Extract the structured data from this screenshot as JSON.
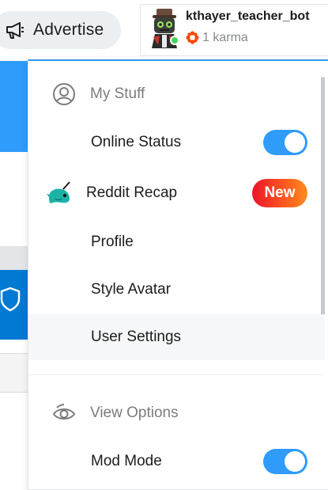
{
  "header": {
    "advertise_label": "Advertise",
    "icon": "megaphone-icon"
  },
  "user": {
    "username": "kthayer_teacher_bot",
    "karma": "1 karma",
    "status_color": "#46d160"
  },
  "menu": {
    "my_stuff": {
      "label": "My Stuff",
      "icon": "user-circle-icon",
      "items": {
        "online_status": {
          "label": "Online Status",
          "toggle": "on"
        },
        "reddit_recap": {
          "label": "Reddit Recap",
          "badge": "New"
        },
        "profile": {
          "label": "Profile"
        },
        "style_avatar": {
          "label": "Style Avatar"
        },
        "user_settings": {
          "label": "User Settings"
        }
      }
    },
    "view_options": {
      "label": "View Options",
      "icon": "eye-icon",
      "items": {
        "mod_mode": {
          "label": "Mod Mode",
          "toggle": "on"
        }
      }
    }
  },
  "colors": {
    "accent": "#2f9bfa",
    "new_badge_start": "#e8142b",
    "new_badge_end": "#ff8b1f"
  }
}
